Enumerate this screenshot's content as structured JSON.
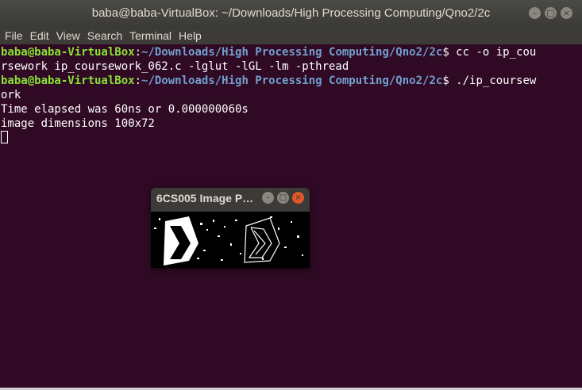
{
  "window": {
    "title": "baba@baba-VirtualBox: ~/Downloads/High Processing Computing/Qno2/2c",
    "controls": [
      "–",
      "□",
      "×"
    ]
  },
  "menu": [
    "File",
    "Edit",
    "View",
    "Search",
    "Terminal",
    "Help"
  ],
  "terminal": {
    "prompt_user": "baba@baba-VirtualBox",
    "prompt_path": "~/Downloads/High Processing Computing/Qno2/2c",
    "cmd1_part1": "cc -o ip_cou",
    "cmd1_part2": "rsework ip_coursework_062.c -lglut -lGL -lm -pthread",
    "cmd2_part1": "./ip_coursew",
    "cmd2_part2": "ork",
    "output1": "Time elapsed was 60ns or 0.000000060s",
    "output2": "image dimensions 100x72"
  },
  "image_window": {
    "title": "6CS005 Image P…",
    "controls": [
      "–",
      "□",
      "×"
    ]
  },
  "colors": {
    "terminal_bg": "#300a24",
    "user": "#8ae234",
    "path": "#729fcf"
  }
}
